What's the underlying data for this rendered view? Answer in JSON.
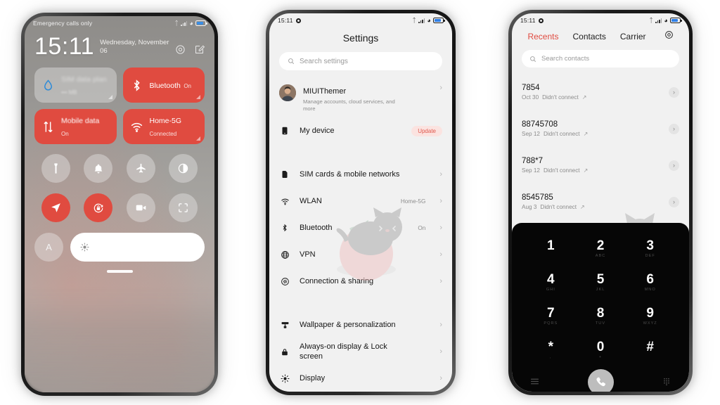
{
  "meta": {
    "accent_red": "#e04b40",
    "screen_bg": "#f1f1f1",
    "keypad_bg": "#060606"
  },
  "phone1": {
    "name": "control-center",
    "statusbar": {
      "carrier": "Emergency calls only",
      "bluetooth": "bt-icon",
      "signal": "signal-icon",
      "wifi": "wifi-icon",
      "battery": "battery-icon"
    },
    "clock": {
      "time": "15:11",
      "date": "Wednesday, November 06"
    },
    "actions": {
      "settings": "settings-gear-icon",
      "edit": "edit-icon"
    },
    "tiles": [
      {
        "id": "sim-data-plan",
        "title": "SIM data plan",
        "subtitle": "•••  MB",
        "state": "off",
        "icon": "water-drop-icon",
        "blurred": true
      },
      {
        "id": "bluetooth",
        "title": "Bluetooth",
        "subtitle": "On",
        "state": "on",
        "icon": "bluetooth-icon",
        "blurred": false
      },
      {
        "id": "mobile-data",
        "title": "Mobile data",
        "subtitle": "On",
        "state": "on",
        "icon": "data-arrows-icon",
        "blurred": false
      },
      {
        "id": "wlan",
        "title": "Home-5G",
        "subtitle": "Connected",
        "state": "on",
        "icon": "wifi-icon",
        "blurred": false
      }
    ],
    "toggles": [
      {
        "id": "flashlight",
        "icon": "flashlight-icon",
        "state": "off"
      },
      {
        "id": "silent",
        "icon": "bell-icon",
        "state": "off"
      },
      {
        "id": "airplane-mode",
        "icon": "airplane-icon",
        "state": "off"
      },
      {
        "id": "dark-mode",
        "icon": "contrast-icon",
        "state": "off"
      },
      {
        "id": "location",
        "icon": "location-icon",
        "state": "on"
      },
      {
        "id": "auto-rotate",
        "icon": "rotation-lock-icon",
        "state": "on"
      },
      {
        "id": "screen-recorder",
        "icon": "video-camera-icon",
        "state": "off"
      },
      {
        "id": "scanner",
        "icon": "scan-icon",
        "state": "off"
      }
    ],
    "brightness": {
      "auto_label": "A",
      "icon": "brightness-icon"
    }
  },
  "phone2": {
    "name": "settings",
    "statusbar": {
      "time": "15:11",
      "alarm": "alarm-icon"
    },
    "title": "Settings",
    "search": {
      "placeholder": "Search settings",
      "icon": "search-icon"
    },
    "account": {
      "name": "MIUIThemer",
      "subtitle": "Manage accounts, cloud services, and more",
      "avatar": "user-avatar"
    },
    "device": {
      "label": "My device",
      "badge": "Update",
      "icon": "phone-icon"
    },
    "group_network": [
      {
        "label": "SIM cards & mobile networks",
        "value": "",
        "icon": "sim-card-icon"
      },
      {
        "label": "WLAN",
        "value": "Home-5G",
        "icon": "wifi-icon"
      },
      {
        "label": "Bluetooth",
        "value": "On",
        "icon": "bluetooth-icon"
      },
      {
        "label": "VPN",
        "value": "",
        "icon": "globe-icon"
      },
      {
        "label": "Connection & sharing",
        "value": "",
        "icon": "connection-sharing-icon"
      }
    ],
    "group_display": [
      {
        "label": "Wallpaper & personalization",
        "value": "",
        "icon": "wallpaper-icon"
      },
      {
        "label": "Always-on display & Lock screen",
        "value": "",
        "icon": "lock-icon"
      },
      {
        "label": "Display",
        "value": "",
        "icon": "brightness-icon"
      }
    ],
    "chevron": "›"
  },
  "phone3": {
    "name": "dialer",
    "statusbar": {
      "time": "15:11",
      "alarm": "alarm-icon"
    },
    "tabs": [
      {
        "label": "Recents",
        "active": true
      },
      {
        "label": "Contacts",
        "active": false
      },
      {
        "label": "Carrier",
        "active": false
      }
    ],
    "settings_icon": "settings-gear-icon",
    "search": {
      "placeholder": "Search contacts",
      "icon": "search-icon"
    },
    "recents": [
      {
        "number": "7854",
        "date": "Oct 30",
        "status": "Didn't connect",
        "direction": "outgoing-call-icon"
      },
      {
        "number": "88745708",
        "date": "Sep 12",
        "status": "Didn't connect",
        "direction": "outgoing-call-icon"
      },
      {
        "number": "788*7",
        "date": "Sep 12",
        "status": "Didn't connect",
        "direction": "outgoing-call-icon"
      },
      {
        "number": "8545785",
        "date": "Aug 3",
        "status": "Didn't connect",
        "direction": "outgoing-call-icon"
      }
    ],
    "keypad": [
      {
        "digit": "1",
        "letters": ""
      },
      {
        "digit": "2",
        "letters": "ABC"
      },
      {
        "digit": "3",
        "letters": "DEF"
      },
      {
        "digit": "4",
        "letters": "GHI"
      },
      {
        "digit": "5",
        "letters": "JKL"
      },
      {
        "digit": "6",
        "letters": "MNO"
      },
      {
        "digit": "7",
        "letters": "PQRS"
      },
      {
        "digit": "8",
        "letters": "TUV"
      },
      {
        "digit": "9",
        "letters": "WXYZ"
      },
      {
        "digit": "*",
        "letters": ","
      },
      {
        "digit": "0",
        "letters": "+"
      },
      {
        "digit": "#",
        "letters": ""
      }
    ],
    "keybar": {
      "menu": "menu-icon",
      "call": "call-icon",
      "keypad": "keypad-icon"
    },
    "chevron": "›"
  }
}
